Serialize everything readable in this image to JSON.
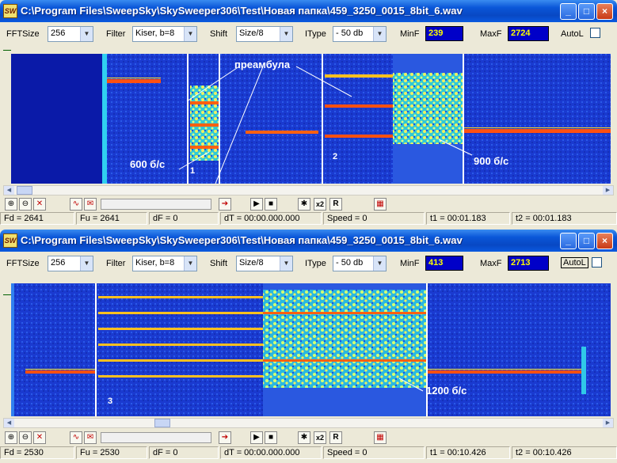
{
  "windows": [
    {
      "title": "C:\\Program Files\\SweepSky\\SkySweeper306\\Test\\Новая папка\\459_3250_0015_8bit_6.wav",
      "app_icon": "SW",
      "toolbar": {
        "fftsize_label": "FFTSize",
        "fftsize_value": "256",
        "filter_label": "Filter",
        "filter_value": "Kiser, b=8",
        "shift_label": "Shift",
        "shift_value": "Size/8",
        "itype_label": "IType",
        "itype_value": "- 50 db",
        "minf_label": "MinF",
        "minf_value": "239",
        "maxf_label": "MaxF",
        "maxf_value": "2724",
        "autol_label": "AutoL"
      },
      "annotations": {
        "preamble": "преамбула",
        "rate1": "600 б/с",
        "rate2": "900 б/с",
        "num1": "1",
        "num2": "2"
      },
      "status": {
        "fd": "Fd = 2641",
        "fu": "Fu = 2641",
        "df": "dF = 0",
        "dt": "dT = 00:00.000.000",
        "speed": "Speed = 0",
        "t1": "t1 = 00:01.183",
        "t2": "t2 = 00:01.183"
      }
    },
    {
      "title": "C:\\Program Files\\SweepSky\\SkySweeper306\\Test\\Новая папка\\459_3250_0015_8bit_6.wav",
      "app_icon": "SW",
      "toolbar": {
        "fftsize_label": "FFTSize",
        "fftsize_value": "256",
        "filter_label": "Filter",
        "filter_value": "Kiser, b=8",
        "shift_label": "Shift",
        "shift_value": "Size/8",
        "itype_label": "IType",
        "itype_value": "- 50 db",
        "minf_label": "MinF",
        "minf_value": "413",
        "maxf_label": "MaxF",
        "maxf_value": "2713",
        "autol_label": "AutoL"
      },
      "annotations": {
        "rate3": "1200 б/с",
        "num3": "3"
      },
      "status": {
        "fd": "Fd = 2530",
        "fu": "Fu = 2530",
        "df": "dF = 0",
        "dt": "dT = 00:00.000.000",
        "speed": "Speed = 0",
        "t1": "t1 = 00:10.426",
        "t2": "t2 = 00:10.426"
      }
    }
  ],
  "buttons": {
    "minimize": "_",
    "maximize": "□",
    "close": "×",
    "x2": "x2",
    "r": "R"
  },
  "icons": [
    "zoom-in-icon",
    "zoom-out-icon",
    "zoom-reset-icon",
    "spectrum-icon",
    "envelope-icon",
    "export-icon",
    "play-icon",
    "stop-icon",
    "marker-icon",
    "palette-icon"
  ],
  "colors": {
    "background_blue": "#1228c0",
    "tone_orange": "#ff5010",
    "tone_yellow": "#ffe020",
    "cursor_white": "#ffffff",
    "value_box": "#0000c8",
    "value_text": "#ffff00"
  }
}
